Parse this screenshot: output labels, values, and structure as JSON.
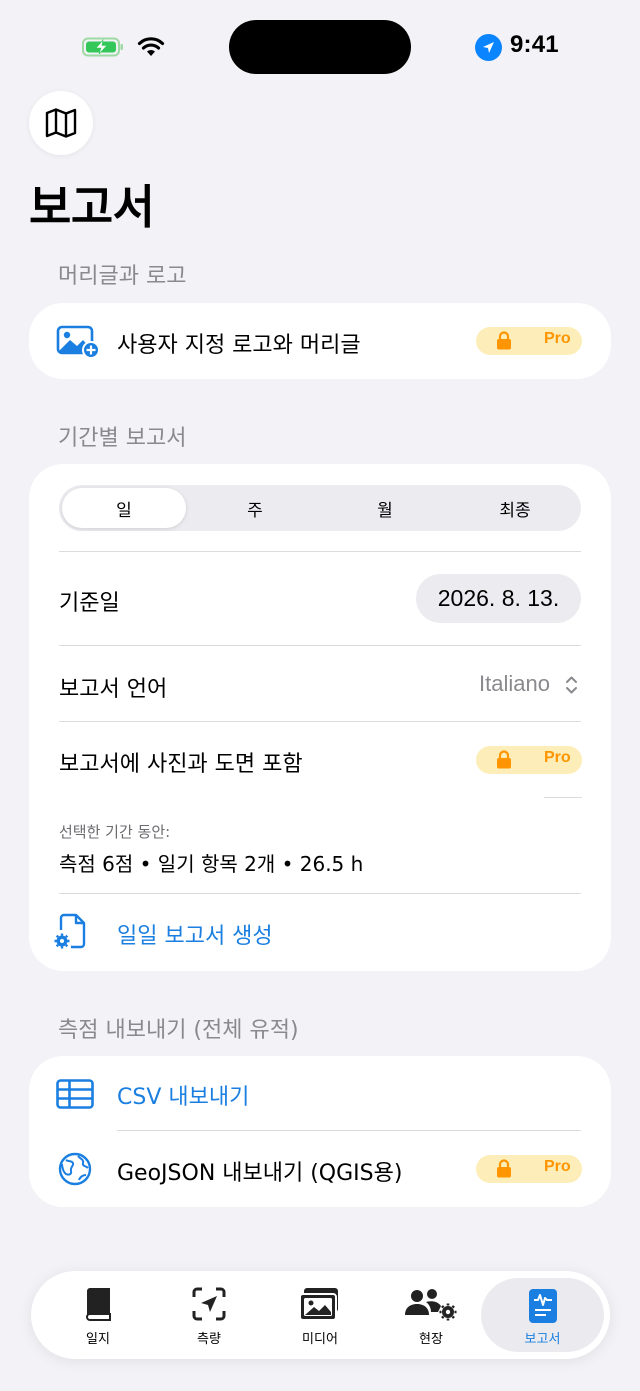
{
  "status": {
    "time": "9:41"
  },
  "page": {
    "title": "보고서"
  },
  "sections": {
    "header_logo": "머리글과 로고",
    "period_report": "기간별 보고서",
    "export": "측점 내보내기 (전체 유적)"
  },
  "logo_card": {
    "label": "사용자 지정 로고와 머리글",
    "badge": "Pro"
  },
  "period_card": {
    "segments": [
      "일",
      "주",
      "월",
      "최종"
    ],
    "selected_segment": "일",
    "base_date_label": "기준일",
    "base_date_value": "2026. 8. 13.",
    "language_label": "보고서 언어",
    "language_value": "Italiano",
    "include_photos_label": "보고서에 사진과 도면 포함",
    "include_photos_badge": "Pro",
    "summary_caption": "선택한 기간 동안:",
    "summary_value": "측점 6점 • 일기 항목 2개 • 26.5 h",
    "generate_label": "일일 보고서 생성"
  },
  "export_card": {
    "csv_label": "CSV 내보내기",
    "geojson_label": "GeoJSON 내보내기 (QGIS용)",
    "geojson_badge": "Pro"
  },
  "tabbar": {
    "items": [
      {
        "label": "일지",
        "icon": "book-icon"
      },
      {
        "label": "측량",
        "icon": "location-scan-icon"
      },
      {
        "label": "미디어",
        "icon": "photos-icon"
      },
      {
        "label": "현장",
        "icon": "people-gear-icon"
      },
      {
        "label": "보고서",
        "icon": "report-icon"
      }
    ],
    "active": "보고서"
  },
  "colors": {
    "accent": "#1a7fe0",
    "pro_badge_bg": "#fdeeb9",
    "pro_badge_fg": "#ff9500",
    "background": "#f2f2f7"
  }
}
